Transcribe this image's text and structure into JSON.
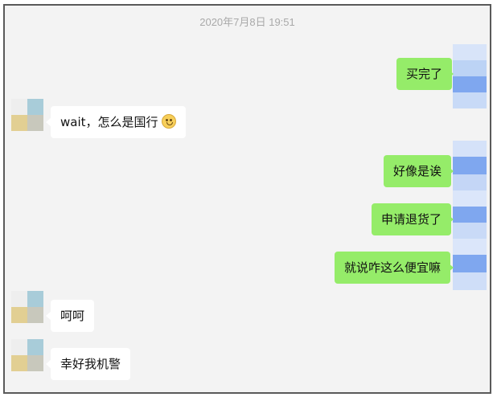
{
  "chat": {
    "timestamp": "2020年7月8日 19:51",
    "messages": [
      {
        "sender": "me",
        "text": "买完了"
      },
      {
        "sender": "them",
        "text": "wait，怎么是国行",
        "emoji": "face-emoji"
      },
      {
        "sender": "me",
        "text": "好像是诶"
      },
      {
        "sender": "me",
        "text": "申请退货了"
      },
      {
        "sender": "me",
        "text": "就说咋这么便宜嘛"
      },
      {
        "sender": "them",
        "text": "呵呵"
      },
      {
        "sender": "them",
        "text": "幸好我机警"
      }
    ]
  },
  "colors": {
    "background": "#f3f3f3",
    "my_bubble": "#95ec69",
    "their_bubble": "#ffffff",
    "timestamp": "#a9a9a9"
  }
}
